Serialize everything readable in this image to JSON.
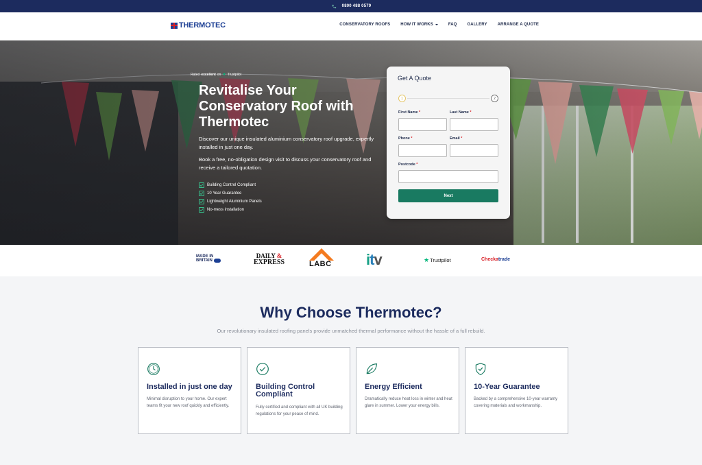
{
  "topbar": {
    "phone": "0800 488 0579",
    "icon": "phone-icon"
  },
  "header": {
    "logo_text": "THERMOTEC",
    "nav": [
      {
        "label": "CONSERVATORY ROOFS"
      },
      {
        "label": "HOW IT WORKS"
      },
      {
        "label": "FAQ"
      },
      {
        "label": "GALLERY"
      },
      {
        "label": "ARRANGE A QUOTE"
      }
    ]
  },
  "hero": {
    "rated_prefix": "Rated",
    "rated_word": "excellent",
    "rated_on": "on",
    "rated_brand": "Trustpilot",
    "title": "Revitalise Your Conservatory Roof with Thermotec",
    "paragraph1": "Discover our unique insulated aluminium conservatory roof upgrade, expertly installed in just one day.",
    "paragraph2": "Book a free, no-obligation design visit to discuss your conservatory roof and receive a tailored quotation.",
    "checks": [
      "Building Control Compliant",
      "10 Year Guarantee",
      "Lightweight Aluminium Panels",
      "No-mess installation"
    ]
  },
  "quote_form": {
    "title": "Get A Quote",
    "step1": "1",
    "step2": "2",
    "first_name_label": "First Name",
    "last_name_label": "Last Name",
    "phone_label": "Phone",
    "email_label": "Email",
    "postcode_label": "Postcode",
    "required_marker": "*",
    "next_label": "Next"
  },
  "logos": {
    "made_in_britain_1": "MADE IN",
    "made_in_britain_2": "BRITAIN",
    "daily_express_1": "DAILY",
    "daily_express_amp": "&",
    "daily_express_2": "EXPRESS",
    "labc": "LABC",
    "itv_i": "i",
    "itv_t": "t",
    "itv_v": "v",
    "trustpilot": "Trustpilot",
    "checkatrade_1": "Checka",
    "checkatrade_2": "trade"
  },
  "why": {
    "title": "Why Choose Thermotec?",
    "subtitle": "Our revolutionary insulated roofing panels provide unmatched thermal performance without the hassle of a full rebuild.",
    "cards": [
      {
        "icon": "clock-icon",
        "title": "Installed in just one day",
        "text": "Minimal disruption to your home. Our expert teams fit your new roof quickly and efficiently."
      },
      {
        "icon": "check-circle-icon",
        "title": "Building Control Compliant",
        "text": "Fully certified and compliant with all UK building regulations for your peace of mind."
      },
      {
        "icon": "leaf-icon",
        "title": "Energy Efficient",
        "text": "Dramatically reduce heat loss in winter and heat glare in summer. Lower your energy bills."
      },
      {
        "icon": "shield-check-icon",
        "title": "10-Year Guarantee",
        "text": "Backed by a comprehensive 10-year warranty covering materials and workmanship."
      }
    ]
  },
  "colors": {
    "navy": "#1c2b5e",
    "brand_red": "#d92128",
    "brand_green": "#197a61",
    "check_green": "#37c08c"
  }
}
